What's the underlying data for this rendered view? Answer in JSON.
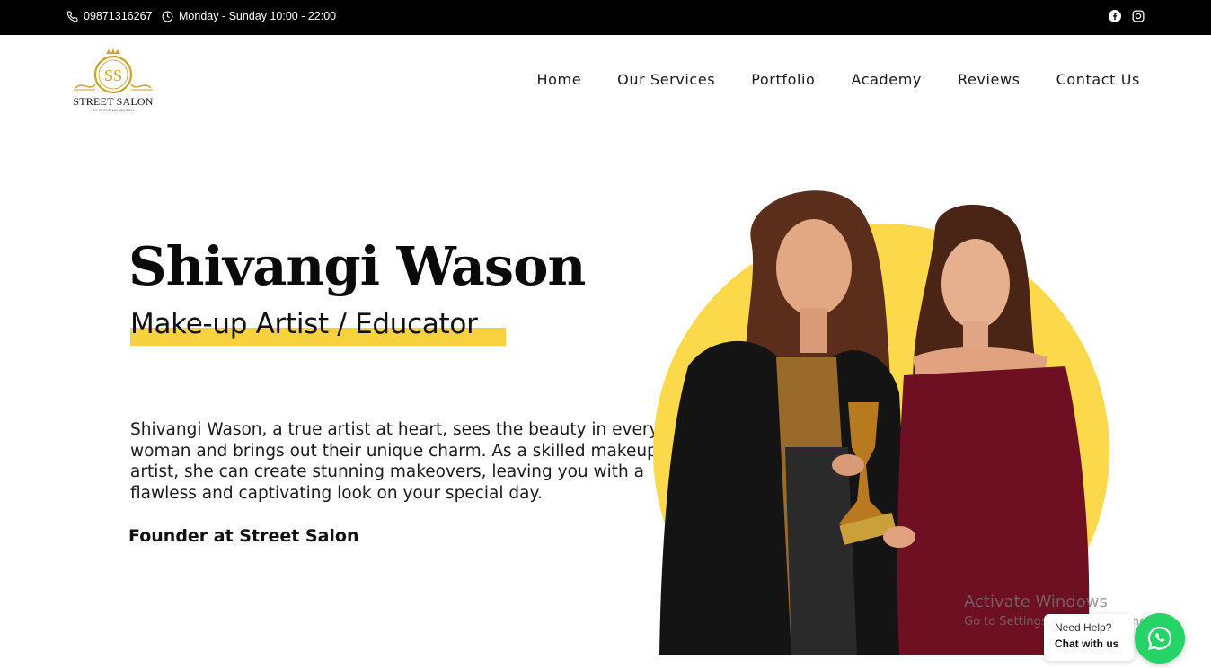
{
  "topbar": {
    "phone": "09871316267",
    "hours": "Monday - Sunday 10:00 - 22:00",
    "social": [
      "facebook-icon",
      "instagram-icon"
    ]
  },
  "logo": {
    "monogram": "SS",
    "name": "STREET SALON",
    "tagline": "BY SHIVANGI WASON"
  },
  "nav": {
    "items": [
      "Home",
      "Our Services",
      "Portfolio",
      "Academy",
      "Reviews",
      "Contact Us"
    ]
  },
  "hero": {
    "title": "Shivangi Wason",
    "subtitle": "Make-up Artist / Educator",
    "bio": "Shivangi Wason, a true artist at heart, sees the beauty in every woman and brings out their unique charm. As a skilled makeup artist, she can create stunning makeovers, leaving you with a flawless and captivating look on your special day.",
    "founder": "Founder at Street Salon"
  },
  "watermark": {
    "line1": "Activate Windows",
    "line2": "Go to Settings to activate Windows."
  },
  "chat": {
    "line1": "Need Help?",
    "line2": "Chat with us"
  },
  "colors": {
    "topbar_bg": "#000000",
    "highlight": "#f8d23e",
    "accent_circle": "#fcd94a",
    "whatsapp": "#25d366",
    "logo_gold": "#c9a227"
  }
}
